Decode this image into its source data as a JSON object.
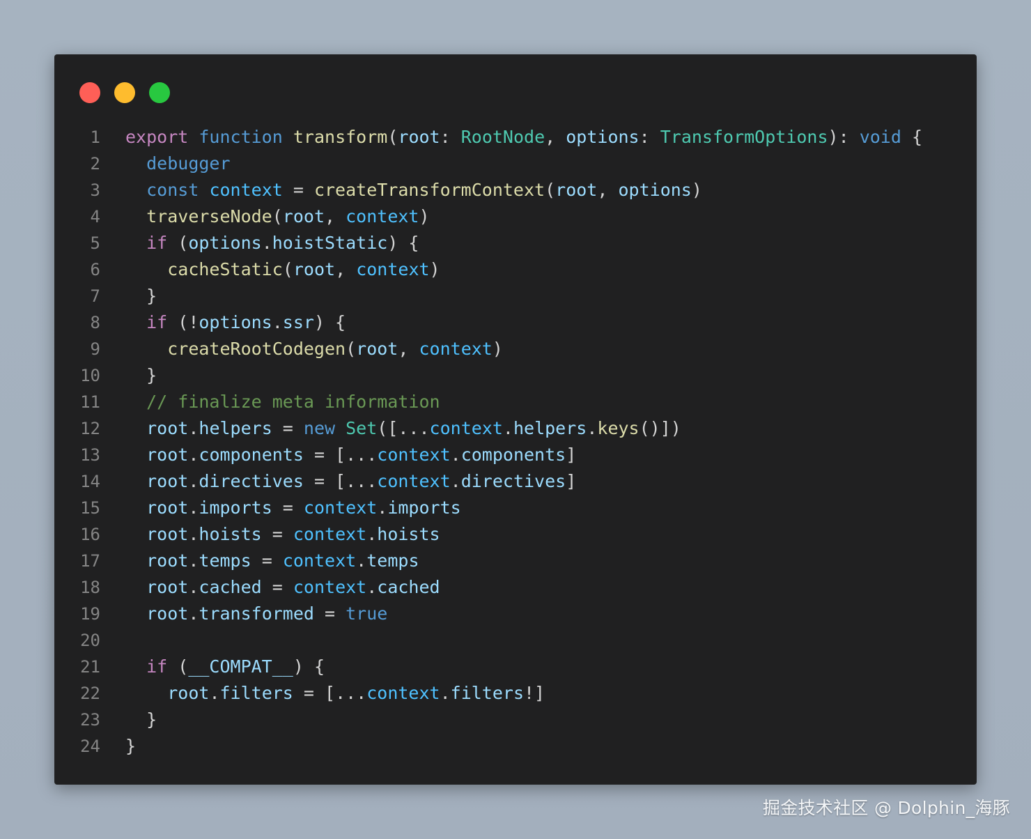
{
  "window": {
    "controls": {
      "close_color": "#fe5f57",
      "minimize_color": "#febc2e",
      "maximize_color": "#28c840"
    }
  },
  "code": {
    "lines": [
      {
        "n": "1",
        "tokens": [
          [
            "export",
            "kw"
          ],
          [
            " ",
            "punc"
          ],
          [
            "function",
            "storage"
          ],
          [
            " ",
            "punc"
          ],
          [
            "transform",
            "fn"
          ],
          [
            "(",
            "punc"
          ],
          [
            "root",
            "var"
          ],
          [
            ": ",
            "punc"
          ],
          [
            "RootNode",
            "type"
          ],
          [
            ", ",
            "punc"
          ],
          [
            "options",
            "var"
          ],
          [
            ": ",
            "punc"
          ],
          [
            "TransformOptions",
            "type"
          ],
          [
            "): ",
            "punc"
          ],
          [
            "void",
            "storage"
          ],
          [
            " {",
            "punc"
          ]
        ]
      },
      {
        "n": "2",
        "tokens": [
          [
            "  ",
            "punc"
          ],
          [
            "debugger",
            "storage"
          ]
        ]
      },
      {
        "n": "3",
        "tokens": [
          [
            "  ",
            "punc"
          ],
          [
            "const",
            "storage"
          ],
          [
            " ",
            "punc"
          ],
          [
            "context",
            "const"
          ],
          [
            " = ",
            "punc"
          ],
          [
            "createTransformContext",
            "fn"
          ],
          [
            "(",
            "punc"
          ],
          [
            "root",
            "var"
          ],
          [
            ", ",
            "punc"
          ],
          [
            "options",
            "var"
          ],
          [
            ")",
            "punc"
          ]
        ]
      },
      {
        "n": "4",
        "tokens": [
          [
            "  ",
            "punc"
          ],
          [
            "traverseNode",
            "fn"
          ],
          [
            "(",
            "punc"
          ],
          [
            "root",
            "var"
          ],
          [
            ", ",
            "punc"
          ],
          [
            "context",
            "const"
          ],
          [
            ")",
            "punc"
          ]
        ]
      },
      {
        "n": "5",
        "tokens": [
          [
            "  ",
            "punc"
          ],
          [
            "if",
            "kw"
          ],
          [
            " (",
            "punc"
          ],
          [
            "options",
            "var"
          ],
          [
            ".",
            "punc"
          ],
          [
            "hoistStatic",
            "var"
          ],
          [
            ") {",
            "punc"
          ]
        ]
      },
      {
        "n": "6",
        "tokens": [
          [
            "    ",
            "punc"
          ],
          [
            "cacheStatic",
            "fn"
          ],
          [
            "(",
            "punc"
          ],
          [
            "root",
            "var"
          ],
          [
            ", ",
            "punc"
          ],
          [
            "context",
            "const"
          ],
          [
            ")",
            "punc"
          ]
        ]
      },
      {
        "n": "7",
        "tokens": [
          [
            "  }",
            "punc"
          ]
        ]
      },
      {
        "n": "8",
        "tokens": [
          [
            "  ",
            "punc"
          ],
          [
            "if",
            "kw"
          ],
          [
            " (!",
            "punc"
          ],
          [
            "options",
            "var"
          ],
          [
            ".",
            "punc"
          ],
          [
            "ssr",
            "var"
          ],
          [
            ") {",
            "punc"
          ]
        ]
      },
      {
        "n": "9",
        "tokens": [
          [
            "    ",
            "punc"
          ],
          [
            "createRootCodegen",
            "fn"
          ],
          [
            "(",
            "punc"
          ],
          [
            "root",
            "var"
          ],
          [
            ", ",
            "punc"
          ],
          [
            "context",
            "const"
          ],
          [
            ")",
            "punc"
          ]
        ]
      },
      {
        "n": "10",
        "tokens": [
          [
            "  }",
            "punc"
          ]
        ]
      },
      {
        "n": "11",
        "tokens": [
          [
            "  ",
            "punc"
          ],
          [
            "// finalize meta information",
            "comment"
          ]
        ]
      },
      {
        "n": "12",
        "tokens": [
          [
            "  ",
            "punc"
          ],
          [
            "root",
            "var"
          ],
          [
            ".",
            "punc"
          ],
          [
            "helpers",
            "var"
          ],
          [
            " = ",
            "punc"
          ],
          [
            "new",
            "storage"
          ],
          [
            " ",
            "punc"
          ],
          [
            "Set",
            "type"
          ],
          [
            "([...",
            "punc"
          ],
          [
            "context",
            "const"
          ],
          [
            ".",
            "punc"
          ],
          [
            "helpers",
            "var"
          ],
          [
            ".",
            "punc"
          ],
          [
            "keys",
            "fn"
          ],
          [
            "()])",
            "punc"
          ]
        ]
      },
      {
        "n": "13",
        "tokens": [
          [
            "  ",
            "punc"
          ],
          [
            "root",
            "var"
          ],
          [
            ".",
            "punc"
          ],
          [
            "components",
            "var"
          ],
          [
            " = [...",
            "punc"
          ],
          [
            "context",
            "const"
          ],
          [
            ".",
            "punc"
          ],
          [
            "components",
            "var"
          ],
          [
            "]",
            "punc"
          ]
        ]
      },
      {
        "n": "14",
        "tokens": [
          [
            "  ",
            "punc"
          ],
          [
            "root",
            "var"
          ],
          [
            ".",
            "punc"
          ],
          [
            "directives",
            "var"
          ],
          [
            " = [...",
            "punc"
          ],
          [
            "context",
            "const"
          ],
          [
            ".",
            "punc"
          ],
          [
            "directives",
            "var"
          ],
          [
            "]",
            "punc"
          ]
        ]
      },
      {
        "n": "15",
        "tokens": [
          [
            "  ",
            "punc"
          ],
          [
            "root",
            "var"
          ],
          [
            ".",
            "punc"
          ],
          [
            "imports",
            "var"
          ],
          [
            " = ",
            "punc"
          ],
          [
            "context",
            "const"
          ],
          [
            ".",
            "punc"
          ],
          [
            "imports",
            "var"
          ]
        ]
      },
      {
        "n": "16",
        "tokens": [
          [
            "  ",
            "punc"
          ],
          [
            "root",
            "var"
          ],
          [
            ".",
            "punc"
          ],
          [
            "hoists",
            "var"
          ],
          [
            " = ",
            "punc"
          ],
          [
            "context",
            "const"
          ],
          [
            ".",
            "punc"
          ],
          [
            "hoists",
            "var"
          ]
        ]
      },
      {
        "n": "17",
        "tokens": [
          [
            "  ",
            "punc"
          ],
          [
            "root",
            "var"
          ],
          [
            ".",
            "punc"
          ],
          [
            "temps",
            "var"
          ],
          [
            " = ",
            "punc"
          ],
          [
            "context",
            "const"
          ],
          [
            ".",
            "punc"
          ],
          [
            "temps",
            "var"
          ]
        ]
      },
      {
        "n": "18",
        "tokens": [
          [
            "  ",
            "punc"
          ],
          [
            "root",
            "var"
          ],
          [
            ".",
            "punc"
          ],
          [
            "cached",
            "var"
          ],
          [
            " = ",
            "punc"
          ],
          [
            "context",
            "const"
          ],
          [
            ".",
            "punc"
          ],
          [
            "cached",
            "var"
          ]
        ]
      },
      {
        "n": "19",
        "tokens": [
          [
            "  ",
            "punc"
          ],
          [
            "root",
            "var"
          ],
          [
            ".",
            "punc"
          ],
          [
            "transformed",
            "var"
          ],
          [
            " = ",
            "punc"
          ],
          [
            "true",
            "storage"
          ]
        ]
      },
      {
        "n": "20",
        "tokens": []
      },
      {
        "n": "21",
        "tokens": [
          [
            "  ",
            "punc"
          ],
          [
            "if",
            "kw"
          ],
          [
            " (",
            "punc"
          ],
          [
            "__COMPAT__",
            "var"
          ],
          [
            ") {",
            "punc"
          ]
        ]
      },
      {
        "n": "22",
        "tokens": [
          [
            "    ",
            "punc"
          ],
          [
            "root",
            "var"
          ],
          [
            ".",
            "punc"
          ],
          [
            "filters",
            "var"
          ],
          [
            " = [...",
            "punc"
          ],
          [
            "context",
            "const"
          ],
          [
            ".",
            "punc"
          ],
          [
            "filters",
            "var"
          ],
          [
            "!]",
            "punc"
          ]
        ]
      },
      {
        "n": "23",
        "tokens": [
          [
            "  }",
            "punc"
          ]
        ]
      },
      {
        "n": "24",
        "tokens": [
          [
            "}",
            "punc"
          ]
        ]
      }
    ]
  },
  "watermark": {
    "text": "掘金技术社区 @ Dolphin_海豚"
  }
}
